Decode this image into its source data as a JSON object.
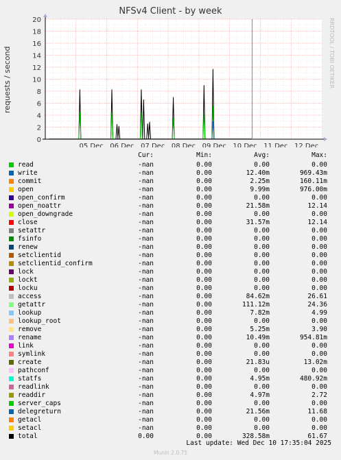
{
  "title": "NFSv4 Client - by week",
  "watermark": "RRDTOOL / TOBI OETIKER",
  "last_update": "Last update: Wed Dec 10 17:35:04 2025",
  "footer": "Munin 2.0.75",
  "headers": {
    "cur": "Cur:",
    "min": "Min:",
    "avg": "Avg:",
    "max": "Max:"
  },
  "legend": [
    {
      "name": "read",
      "color": "#00cc00",
      "cur": "-nan",
      "min": "0.00",
      "avg": "0.00",
      "max": "0.00"
    },
    {
      "name": "write",
      "color": "#0066b3",
      "cur": "-nan",
      "min": "0.00",
      "avg": "12.40m",
      "max": "969.43m"
    },
    {
      "name": "commit",
      "color": "#ff8000",
      "cur": "-nan",
      "min": "0.00",
      "avg": "2.25m",
      "max": "160.11m"
    },
    {
      "name": "open",
      "color": "#ffcc00",
      "cur": "-nan",
      "min": "0.00",
      "avg": "9.99m",
      "max": "976.00m"
    },
    {
      "name": "open_confirm",
      "color": "#330099",
      "cur": "-nan",
      "min": "0.00",
      "avg": "0.00",
      "max": "0.00"
    },
    {
      "name": "open_noattr",
      "color": "#990099",
      "cur": "-nan",
      "min": "0.00",
      "avg": "21.58m",
      "max": "12.14"
    },
    {
      "name": "open_downgrade",
      "color": "#ccff00",
      "cur": "-nan",
      "min": "0.00",
      "avg": "0.00",
      "max": "0.00"
    },
    {
      "name": "close",
      "color": "#ff0000",
      "cur": "-nan",
      "min": "0.00",
      "avg": "31.57m",
      "max": "12.14"
    },
    {
      "name": "setattr",
      "color": "#808080",
      "cur": "-nan",
      "min": "0.00",
      "avg": "0.00",
      "max": "0.00"
    },
    {
      "name": "fsinfo",
      "color": "#008f00",
      "cur": "-nan",
      "min": "0.00",
      "avg": "0.00",
      "max": "0.00"
    },
    {
      "name": "renew",
      "color": "#00487d",
      "cur": "-nan",
      "min": "0.00",
      "avg": "0.00",
      "max": "0.00"
    },
    {
      "name": "setclientid",
      "color": "#b35a00",
      "cur": "-nan",
      "min": "0.00",
      "avg": "0.00",
      "max": "0.00"
    },
    {
      "name": "setclientid_confirm",
      "color": "#b38f00",
      "cur": "-nan",
      "min": "0.00",
      "avg": "0.00",
      "max": "0.00"
    },
    {
      "name": "lock",
      "color": "#6b006b",
      "cur": "-nan",
      "min": "0.00",
      "avg": "0.00",
      "max": "0.00"
    },
    {
      "name": "lockt",
      "color": "#8fb300",
      "cur": "-nan",
      "min": "0.00",
      "avg": "0.00",
      "max": "0.00"
    },
    {
      "name": "locku",
      "color": "#b30000",
      "cur": "-nan",
      "min": "0.00",
      "avg": "0.00",
      "max": "0.00"
    },
    {
      "name": "access",
      "color": "#bebebe",
      "cur": "-nan",
      "min": "0.00",
      "avg": "84.62m",
      "max": "26.61"
    },
    {
      "name": "getattr",
      "color": "#80ff80",
      "cur": "-nan",
      "min": "0.00",
      "avg": "111.12m",
      "max": "24.36"
    },
    {
      "name": "lookup",
      "color": "#80c9ff",
      "cur": "-nan",
      "min": "0.00",
      "avg": "7.82m",
      "max": "4.99"
    },
    {
      "name": "lookup_root",
      "color": "#ffc080",
      "cur": "-nan",
      "min": "0.00",
      "avg": "0.00",
      "max": "0.00"
    },
    {
      "name": "remove",
      "color": "#ffe680",
      "cur": "-nan",
      "min": "0.00",
      "avg": "5.25m",
      "max": "3.90"
    },
    {
      "name": "rename",
      "color": "#aa80ff",
      "cur": "-nan",
      "min": "0.00",
      "avg": "10.49m",
      "max": "954.81m"
    },
    {
      "name": "link",
      "color": "#ee00cc",
      "cur": "-nan",
      "min": "0.00",
      "avg": "0.00",
      "max": "0.00"
    },
    {
      "name": "symlink",
      "color": "#ff8080",
      "cur": "-nan",
      "min": "0.00",
      "avg": "0.00",
      "max": "0.00"
    },
    {
      "name": "create",
      "color": "#666600",
      "cur": "-nan",
      "min": "0.00",
      "avg": "21.83u",
      "max": "13.02m"
    },
    {
      "name": "pathconf",
      "color": "#ffbfff",
      "cur": "-nan",
      "min": "0.00",
      "avg": "0.00",
      "max": "0.00"
    },
    {
      "name": "statfs",
      "color": "#00ffcc",
      "cur": "-nan",
      "min": "0.00",
      "avg": "4.95m",
      "max": "480.92m"
    },
    {
      "name": "readlink",
      "color": "#cc6699",
      "cur": "-nan",
      "min": "0.00",
      "avg": "0.00",
      "max": "0.00"
    },
    {
      "name": "readdir",
      "color": "#999900",
      "cur": "-nan",
      "min": "0.00",
      "avg": "4.97m",
      "max": "2.72"
    },
    {
      "name": "server_caps",
      "color": "#00cc00",
      "cur": "-nan",
      "min": "0.00",
      "avg": "0.00",
      "max": "0.00"
    },
    {
      "name": "delegreturn",
      "color": "#0066b3",
      "cur": "-nan",
      "min": "0.00",
      "avg": "21.56m",
      "max": "11.68"
    },
    {
      "name": "getacl",
      "color": "#ff8000",
      "cur": "-nan",
      "min": "0.00",
      "avg": "0.00",
      "max": "0.00"
    },
    {
      "name": "setacl",
      "color": "#ffcc00",
      "cur": "-nan",
      "min": "0.00",
      "avg": "0.00",
      "max": "0.00"
    },
    {
      "name": "total",
      "color": "#000000",
      "cur": "0.00",
      "min": "0.00",
      "avg": "328.58m",
      "max": "61.67"
    }
  ],
  "chart_data": {
    "type": "line",
    "title": "NFSv4 Client - by week",
    "ylabel": "requests / second",
    "ylim": [
      0,
      20
    ],
    "yticks": [
      0,
      2,
      4,
      6,
      8,
      10,
      12,
      14,
      16,
      18,
      20
    ],
    "xlim": [
      "2025-12-04",
      "2025-12-13"
    ],
    "xticks": [
      "05 Dec",
      "06 Dec",
      "07 Dec",
      "08 Dec",
      "09 Dec",
      "10 Dec",
      "11 Dec",
      "12 Dec"
    ],
    "grid": true,
    "now_marker": "2025-12-10 17:35",
    "series": [
      {
        "name": "total",
        "color": "#000000",
        "x": [
          "2025-12-05 03:00",
          "2025-12-06 04:00",
          "2025-12-06 08:00",
          "2025-12-06 09:30",
          "2025-12-07 03:00",
          "2025-12-07 04:50",
          "2025-12-07 08:00",
          "2025-12-07 09:30",
          "2025-12-08 04:00",
          "2025-12-09 04:00",
          "2025-12-09 11:00"
        ],
        "values": [
          8.3,
          8.3,
          2.5,
          2.2,
          8.3,
          6.6,
          2.6,
          2.9,
          7.0,
          9.0,
          11.7
        ]
      },
      {
        "name": "getattr",
        "color": "#00cc00",
        "x": [
          "2025-12-05 03:00",
          "2025-12-06 04:00",
          "2025-12-07 03:00",
          "2025-12-08 04:00",
          "2025-12-09 04:00",
          "2025-12-09 11:00"
        ],
        "values": [
          4.5,
          4.5,
          4.5,
          3.5,
          4.5,
          5.5
        ]
      },
      {
        "name": "delegreturn",
        "color": "#0066b3",
        "x": [
          "2025-12-09 11:00"
        ],
        "values": [
          3.0
        ]
      }
    ]
  }
}
